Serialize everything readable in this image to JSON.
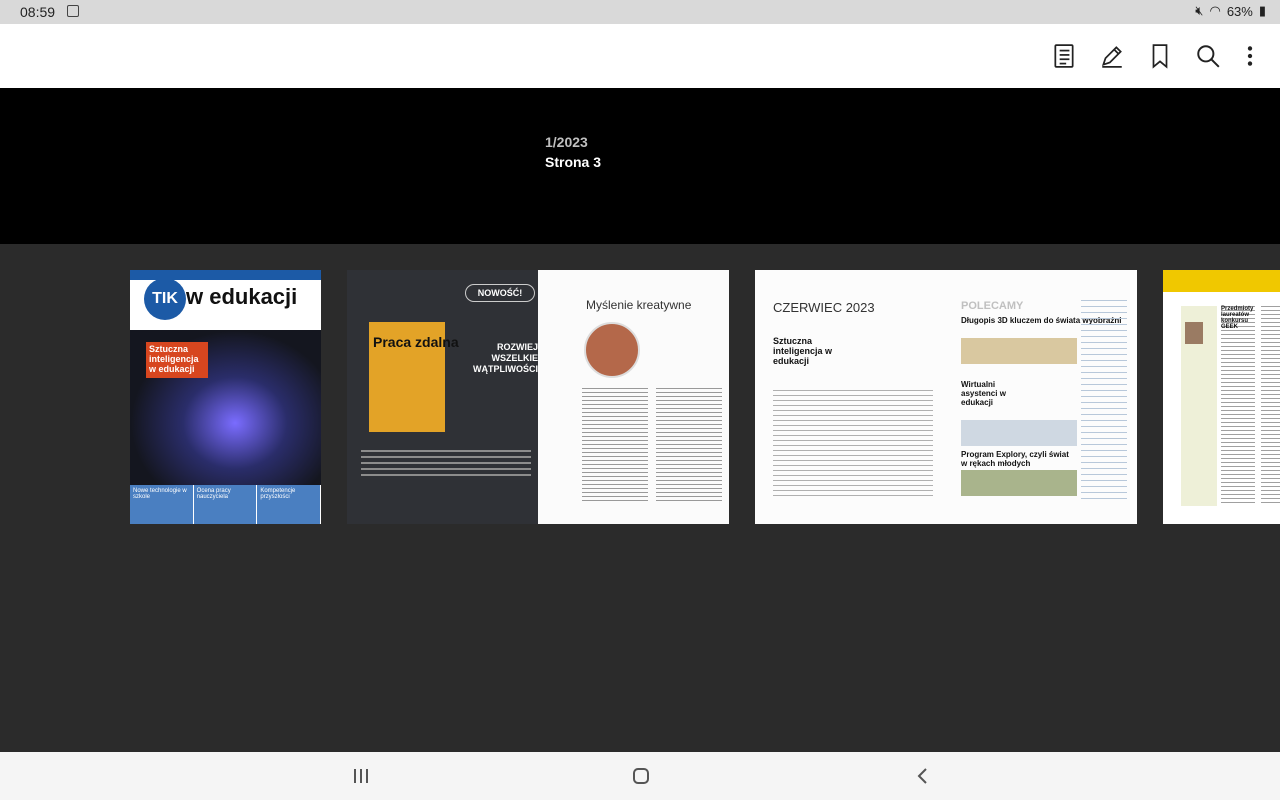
{
  "status_bar": {
    "time": "08:59",
    "battery": "63%"
  },
  "toolbar": {
    "icons": [
      "contents-icon",
      "annotate-icon",
      "bookmark-icon",
      "search-icon",
      "more-icon"
    ]
  },
  "header": {
    "issue": "1/2023",
    "page_label": "Strona 3"
  },
  "thumbnails": {
    "cover": {
      "tik": "TIK",
      "masthead": "w edukacji",
      "headline": "Sztuczna inteligencja w edukacji",
      "sections": [
        "Nowe technologie w szkole",
        "Ocena pracy nauczyciela",
        "Kompetencje przyszłości"
      ]
    },
    "spread_a": {
      "book": "Praca zdalna",
      "badge": "NOWOŚĆ!",
      "promo": "ROZWIEJ WSZELKIE WĄTPLIWOŚCI",
      "heading": "Myślenie kreatywne"
    },
    "spread_b": {
      "month": "CZERWIEC 2023",
      "topic": "Sztuczna inteligencja w edukacji",
      "recommend": "POLECAMY",
      "features": [
        "Długopis 3D kluczem do świata wyobraźni",
        "Wirtualni asystenci w edukacji",
        "Program Explory, czyli świat w rękach młodych"
      ]
    },
    "spread_c": {
      "headline": "Przedmioty laureatów konkursu GEEK"
    }
  }
}
